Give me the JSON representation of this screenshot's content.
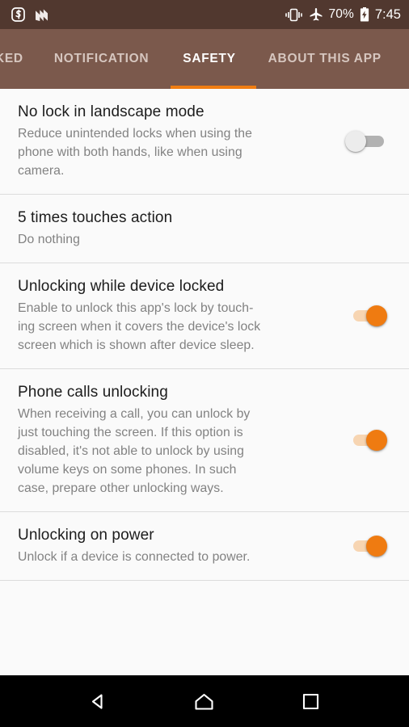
{
  "status_bar": {
    "left_icons": [
      "app-notification-icon",
      "nova-launcher-icon"
    ],
    "vibrate_icon": "vibrate-icon",
    "airplane_icon": "airplane-mode-icon",
    "battery_percent": "70%",
    "battery_icon": "battery-charging-icon",
    "time": "7:45"
  },
  "tabs": [
    {
      "label": "KED",
      "active": false
    },
    {
      "label": "NOTIFICATION",
      "active": false
    },
    {
      "label": "SAFETY",
      "active": true
    },
    {
      "label": "ABOUT THIS APP",
      "active": false
    }
  ],
  "accent_color": "#f07d12",
  "header_color": "#7b594c",
  "statusbar_color": "#51382f",
  "settings": [
    {
      "title": "No lock in landscape mode",
      "desc": "Reduce unintended locks when using the\nphone with both hands, like when using\ncamera.",
      "control": "switch",
      "state": "off"
    },
    {
      "title": "5 times touches action",
      "desc": "Do nothing",
      "control": "none",
      "state": ""
    },
    {
      "title": "Unlocking while device locked",
      "desc": "Enable to unlock this app's lock by touch-\ning screen when it covers the device's lock\nscreen which is shown after device sleep.",
      "control": "switch",
      "state": "on"
    },
    {
      "title": "Phone calls unlocking",
      "desc": "When receiving a call, you can unlock by\njust touching the screen. If this option is\ndisabled, it's not able to unlock by using\nvolume keys on some phones. In such\ncase, prepare other unlocking ways.",
      "control": "switch",
      "state": "on"
    },
    {
      "title": "Unlocking on power",
      "desc": "Unlock if a device is connected to power.",
      "control": "switch",
      "state": "on"
    }
  ],
  "nav_bar": {
    "back": "back-nav-icon",
    "home": "home-nav-icon",
    "recents": "recents-nav-icon"
  }
}
